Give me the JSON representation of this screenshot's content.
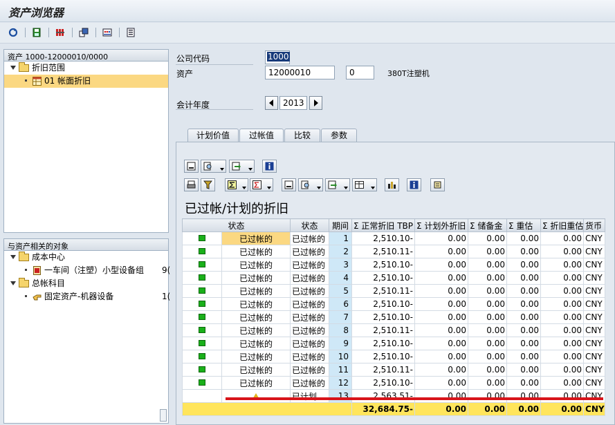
{
  "window": {
    "title": "资产浏览器"
  },
  "toolbar": {
    "buttons": [
      {
        "name": "refresh-icon"
      },
      {
        "name": "save-icon"
      },
      {
        "name": "print-icon"
      },
      {
        "name": "layout-icon"
      },
      {
        "name": "grid-icon"
      },
      {
        "name": "list-icon"
      }
    ]
  },
  "left_tree": {
    "header": "资产 1000-12000010/0000",
    "nodes": [
      {
        "label": "折旧范围",
        "type": "folder"
      },
      {
        "label": "01  帐面折旧",
        "type": "item",
        "selected": true
      }
    ]
  },
  "related_tree": {
    "header": "与资产相关的对象",
    "nodes": [
      {
        "label": "成本中心",
        "type": "folder"
      },
      {
        "label": "一车间（注塑）小型设备组",
        "type": "item",
        "suffix": "9("
      },
      {
        "label": "总帐科目",
        "type": "folder"
      },
      {
        "label": "固定资产-机器设备",
        "type": "item",
        "suffix": "1("
      }
    ]
  },
  "form": {
    "company_code_label": "公司代码",
    "company_code_value": "1000",
    "asset_label": "资产",
    "asset_value": "12000010",
    "asset_sub_value": "0",
    "asset_description": "380T注塑机",
    "fiscal_year_label": "会计年度",
    "fiscal_year_value": "2013"
  },
  "tabs": [
    "计划价值",
    "过帐值",
    "比较",
    "参数"
  ],
  "active_tab": "过帐值",
  "grid": {
    "title": "已过帐/计划的折旧",
    "columns": [
      "状态",
      "状态",
      "期间",
      "Σ 正常折旧 TBP",
      "Σ 计划外折旧",
      "Σ 储备金",
      "Σ    重估",
      "Σ 折旧重估",
      "货币"
    ],
    "rows": [
      {
        "status": "已过帐的",
        "status2": "已过帐的",
        "period": "1",
        "normal": "2,510.10-",
        "unplanned": "0.00",
        "reserve": "0.00",
        "reval": "0.00",
        "depreval": "0.00",
        "currency": "CNY",
        "icon": "posted"
      },
      {
        "status": "已过帐的",
        "status2": "已过帐的",
        "period": "2",
        "normal": "2,510.11-",
        "unplanned": "0.00",
        "reserve": "0.00",
        "reval": "0.00",
        "depreval": "0.00",
        "currency": "CNY",
        "icon": "posted"
      },
      {
        "status": "已过帐的",
        "status2": "已过帐的",
        "period": "3",
        "normal": "2,510.10-",
        "unplanned": "0.00",
        "reserve": "0.00",
        "reval": "0.00",
        "depreval": "0.00",
        "currency": "CNY",
        "icon": "posted"
      },
      {
        "status": "已过帐的",
        "status2": "已过帐的",
        "period": "4",
        "normal": "2,510.10-",
        "unplanned": "0.00",
        "reserve": "0.00",
        "reval": "0.00",
        "depreval": "0.00",
        "currency": "CNY",
        "icon": "posted"
      },
      {
        "status": "已过帐的",
        "status2": "已过帐的",
        "period": "5",
        "normal": "2,510.11-",
        "unplanned": "0.00",
        "reserve": "0.00",
        "reval": "0.00",
        "depreval": "0.00",
        "currency": "CNY",
        "icon": "posted"
      },
      {
        "status": "已过帐的",
        "status2": "已过帐的",
        "period": "6",
        "normal": "2,510.10-",
        "unplanned": "0.00",
        "reserve": "0.00",
        "reval": "0.00",
        "depreval": "0.00",
        "currency": "CNY",
        "icon": "posted"
      },
      {
        "status": "已过帐的",
        "status2": "已过帐的",
        "period": "7",
        "normal": "2,510.10-",
        "unplanned": "0.00",
        "reserve": "0.00",
        "reval": "0.00",
        "depreval": "0.00",
        "currency": "CNY",
        "icon": "posted"
      },
      {
        "status": "已过帐的",
        "status2": "已过帐的",
        "period": "8",
        "normal": "2,510.11-",
        "unplanned": "0.00",
        "reserve": "0.00",
        "reval": "0.00",
        "depreval": "0.00",
        "currency": "CNY",
        "icon": "posted"
      },
      {
        "status": "已过帐的",
        "status2": "已过帐的",
        "period": "9",
        "normal": "2,510.10-",
        "unplanned": "0.00",
        "reserve": "0.00",
        "reval": "0.00",
        "depreval": "0.00",
        "currency": "CNY",
        "icon": "posted"
      },
      {
        "status": "已过帐的",
        "status2": "已过帐的",
        "period": "10",
        "normal": "2,510.10-",
        "unplanned": "0.00",
        "reserve": "0.00",
        "reval": "0.00",
        "depreval": "0.00",
        "currency": "CNY",
        "icon": "posted"
      },
      {
        "status": "已过帐的",
        "status2": "已过帐的",
        "period": "11",
        "normal": "2,510.11-",
        "unplanned": "0.00",
        "reserve": "0.00",
        "reval": "0.00",
        "depreval": "0.00",
        "currency": "CNY",
        "icon": "posted"
      },
      {
        "status": "已过帐的",
        "status2": "已过帐的",
        "period": "12",
        "normal": "2,510.10-",
        "unplanned": "0.00",
        "reserve": "0.00",
        "reval": "0.00",
        "depreval": "0.00",
        "currency": "CNY",
        "icon": "posted"
      },
      {
        "status": "",
        "status2": "已计划",
        "period": "13",
        "normal": "2,563.51-",
        "unplanned": "0.00",
        "reserve": "0.00",
        "reval": "0.00",
        "depreval": "0.00",
        "currency": "CNY",
        "icon": "planned"
      }
    ],
    "total": {
      "normal": "32,684.75-",
      "unplanned": "0.00",
      "reserve": "0.00",
      "reval": "0.00",
      "depreval": "0.00",
      "currency": "CNY"
    }
  },
  "colors": {
    "selection": "#fbd882",
    "total_row": "#ffe55c",
    "period_col": "#cfe8f7",
    "status_led": "#1ab01a",
    "red_underline": "#d8141a"
  }
}
